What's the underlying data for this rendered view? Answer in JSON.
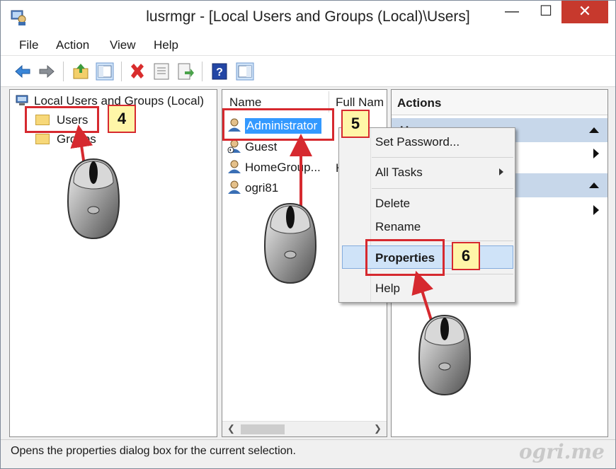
{
  "window": {
    "title": "lusrmgr - [Local Users and Groups (Local)\\Users]",
    "controls": {
      "minimize": "—",
      "maximize": "☐",
      "close": "✕"
    }
  },
  "menu": [
    "File",
    "Action",
    "View",
    "Help"
  ],
  "toolbar_icons": [
    "back-arrow-icon",
    "forward-arrow-icon",
    "up-folder-icon",
    "show-hide-tree-icon",
    "delete-icon",
    "properties-icon",
    "export-list-icon",
    "help-icon",
    "show-hide-action-pane-icon"
  ],
  "tree": {
    "root": "Local Users and Groups (Local)",
    "nodes": [
      "Users",
      "Groups"
    ]
  },
  "list": {
    "columns": [
      "Name",
      "Full Nam"
    ],
    "rows": [
      {
        "name": "Administrator",
        "full_name": ""
      },
      {
        "name": "Guest",
        "full_name": ""
      },
      {
        "name": "HomeGroup...",
        "full_name": "H"
      },
      {
        "name": "ogri81",
        "full_name": ""
      }
    ]
  },
  "actions": {
    "title": "Actions",
    "sections": [
      "Users",
      ""
    ]
  },
  "context_menu": {
    "items": [
      "Set Password...",
      "All Tasks",
      "Delete",
      "Rename",
      "Properties",
      "Help"
    ]
  },
  "status": "Opens the properties dialog box for the current selection.",
  "watermark": "ogri.me",
  "callouts": [
    "4",
    "5",
    "6"
  ],
  "colors": {
    "highlight": "#3399ff",
    "callout_red": "#d6292f",
    "badge_fill": "#fff6a8",
    "close_red": "#c7392d"
  }
}
